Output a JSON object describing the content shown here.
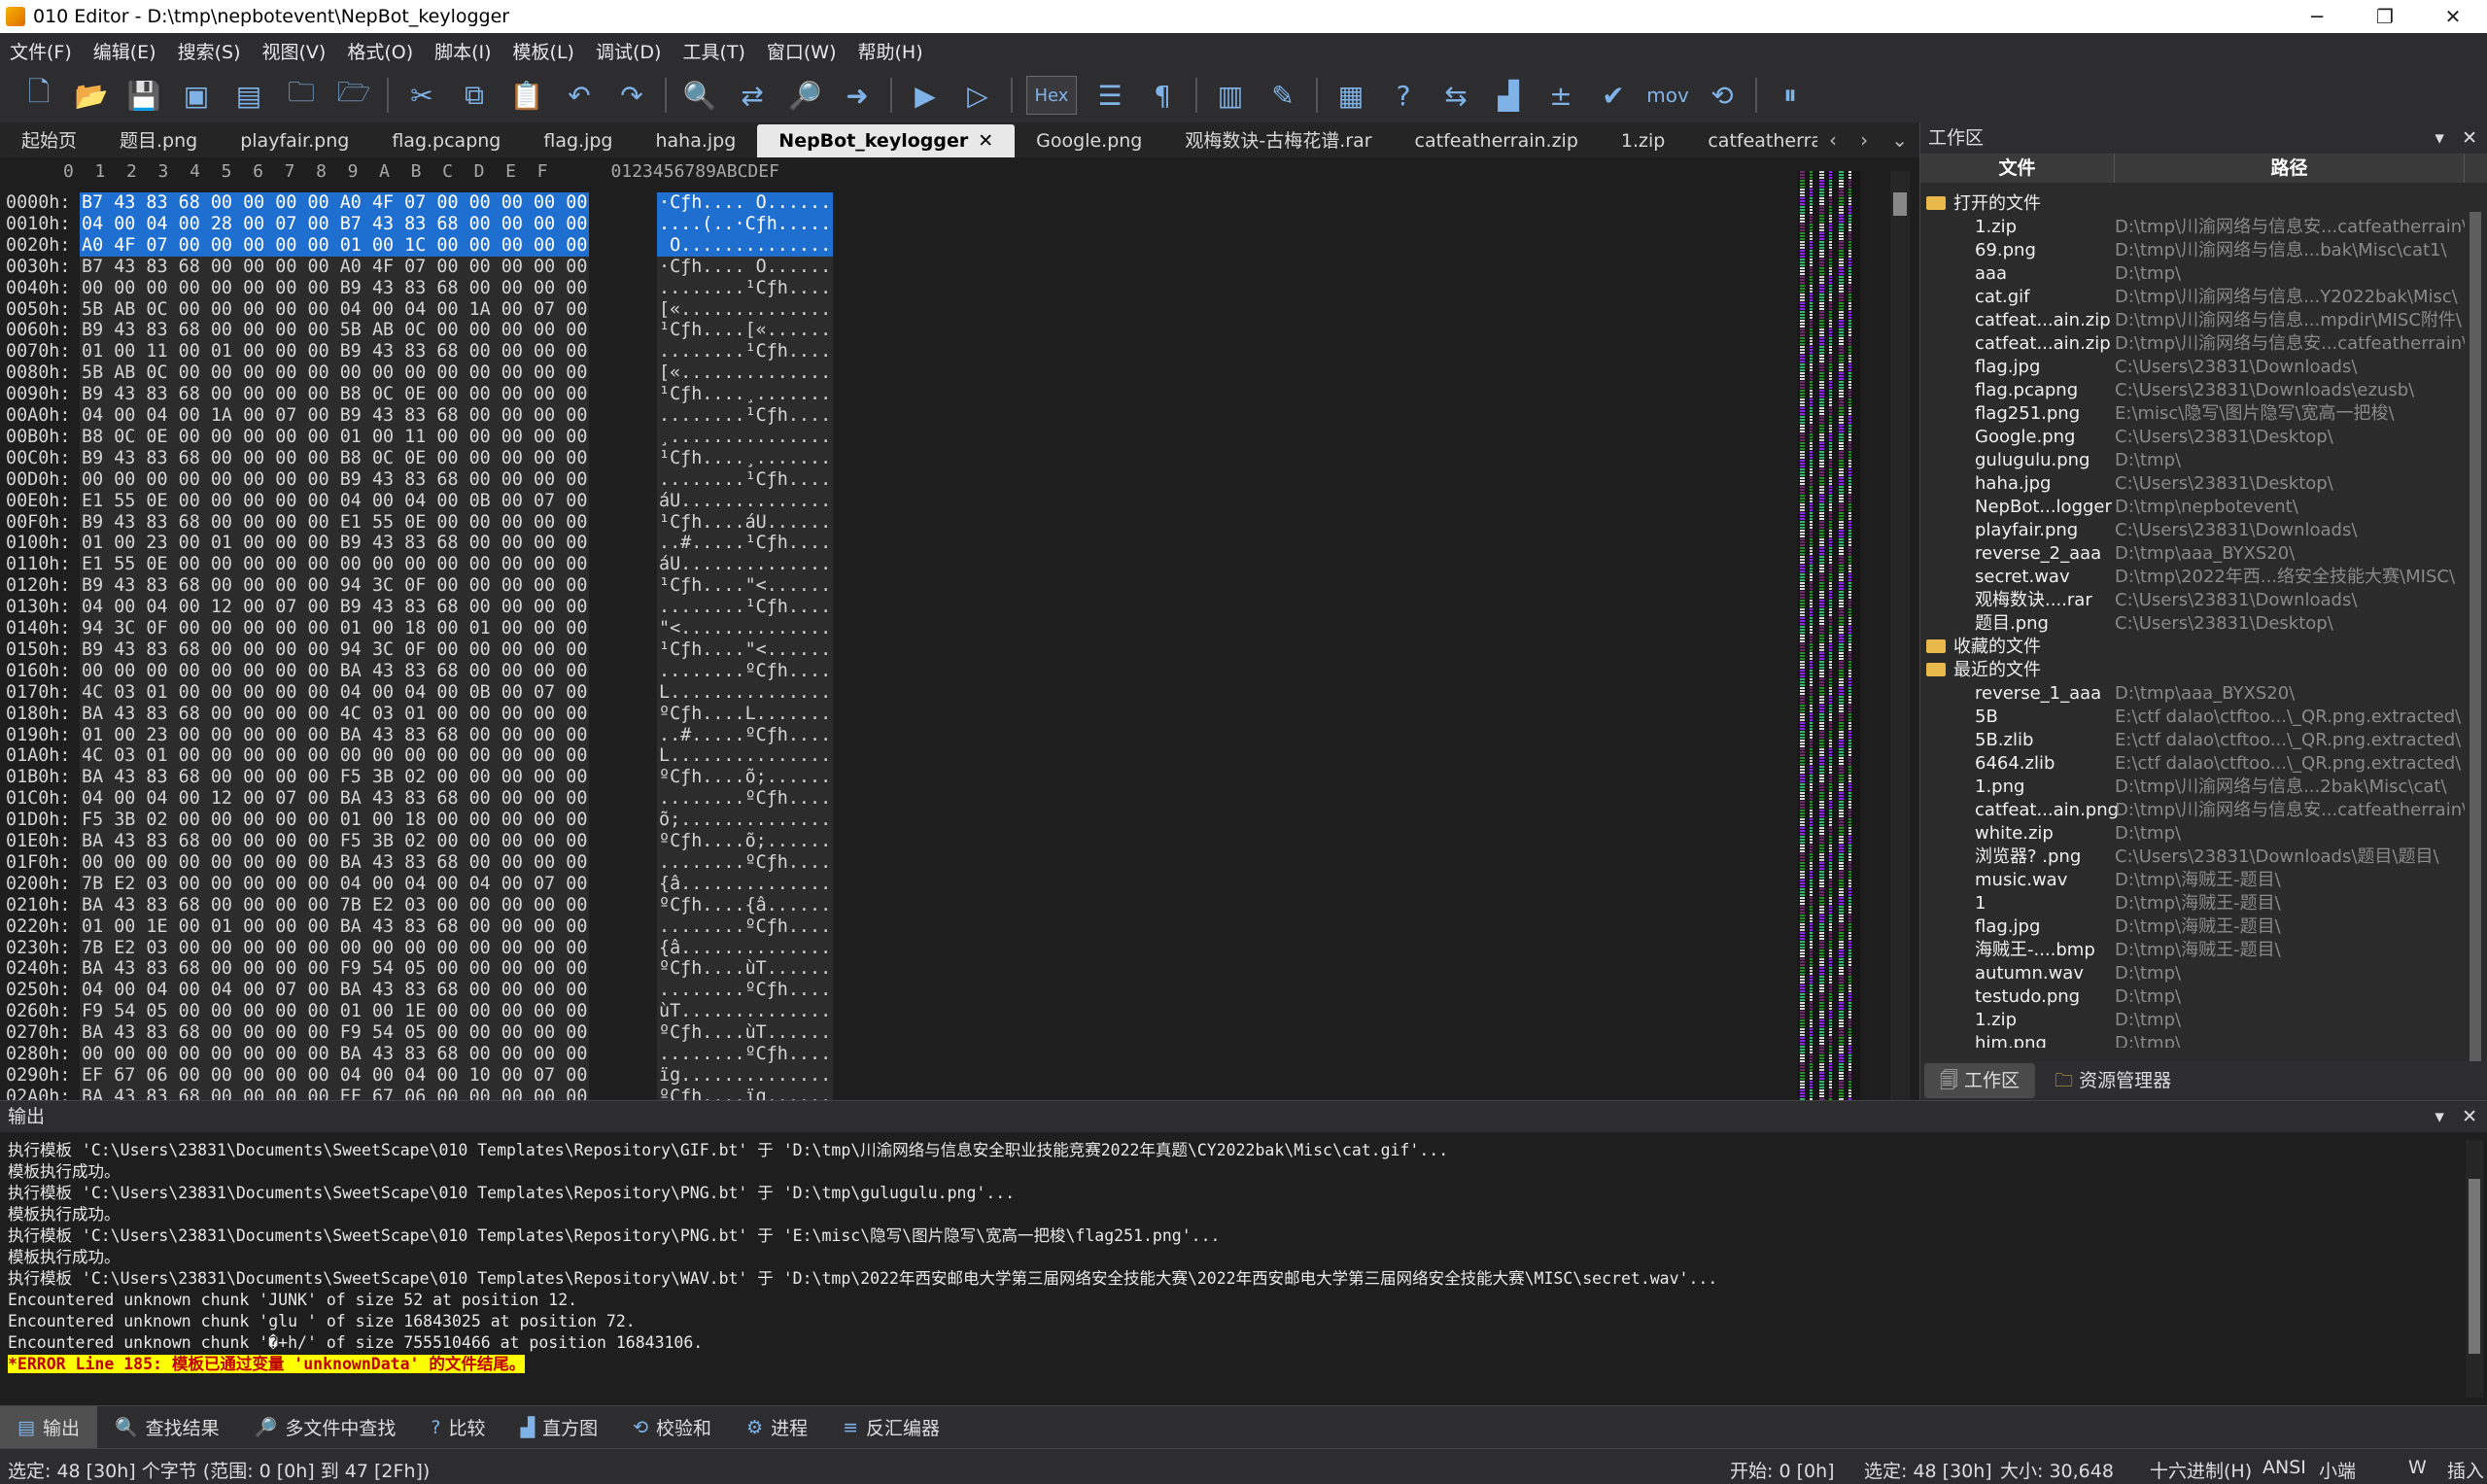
{
  "window": {
    "title": "010 Editor - D:\\tmp\\nepbotevent\\NepBot_keylogger",
    "minimize": "─",
    "maximize": "❐",
    "close": "✕"
  },
  "menu": [
    "文件(F)",
    "编辑(E)",
    "搜索(S)",
    "视图(V)",
    "格式(O)",
    "脚本(I)",
    "模板(L)",
    "调试(D)",
    "工具(T)",
    "窗口(W)",
    "帮助(H)"
  ],
  "toolbar": {
    "hex_label": "Hex",
    "mov_label": "mov",
    "icons": [
      "new-file-icon",
      "open-file-icon",
      "save-icon",
      "save-as-icon",
      "save-all-icon",
      "folder-icon",
      "open-folder-icon",
      "cut-icon",
      "copy-icon",
      "paste-icon",
      "undo-icon",
      "redo-icon",
      "find-icon",
      "replace-icon",
      "find-in-files-icon",
      "goto-icon",
      "run-script-icon",
      "run-template-icon",
      "hex-mode-icon",
      "edit-as-icon",
      "pilcrow-icon",
      "columns-icon",
      "highlight-icon",
      "calculator-icon",
      "inspector-icon",
      "compare-icon",
      "histogram-icon",
      "checksum-icon",
      "arithmetic-icon",
      "mov-icon",
      "base-convert-icon",
      "pause-icon"
    ]
  },
  "tabs": [
    "起始页",
    "题目.png",
    "playfair.png",
    "flag.pcapng",
    "flag.jpg",
    "haha.jpg",
    "NepBot_keylogger",
    "Google.png",
    "观梅数诀-古梅花谱.rar",
    "catfeatherrain.zip",
    "1.zip",
    "catfeatherrain"
  ],
  "active_tab": "NepBot_keylogger",
  "hex": {
    "header": "      0  1  2  3  4  5  6  7  8  9  A  B  C  D  E  F      0123456789ABCDEF",
    "rows": [
      {
        "addr": "0000h:",
        "bytes": "B7 43 83 68 00 00 00 00 A0 4F 07 00 00 00 00 00",
        "ascii": "·Cƒh.... O......"
      },
      {
        "addr": "0010h:",
        "bytes": "04 00 04 00 28 00 07 00 B7 43 83 68 00 00 00 00",
        "ascii": "....(..·Cƒh....."
      },
      {
        "addr": "0020h:",
        "bytes": "A0 4F 07 00 00 00 00 00 01 00 1C 00 00 00 00 00",
        "ascii": " O.............."
      },
      {
        "addr": "0030h:",
        "bytes": "B7 43 83 68 00 00 00 00 A0 4F 07 00 00 00 00 00",
        "ascii": "·Cƒh.... O......"
      },
      {
        "addr": "0040h:",
        "bytes": "00 00 00 00 00 00 00 00 B9 43 83 68 00 00 00 00",
        "ascii": "........¹Cƒh...."
      },
      {
        "addr": "0050h:",
        "bytes": "5B AB 0C 00 00 00 00 00 04 00 04 00 1A 00 07 00",
        "ascii": "[«.............."
      },
      {
        "addr": "0060h:",
        "bytes": "B9 43 83 68 00 00 00 00 5B AB 0C 00 00 00 00 00",
        "ascii": "¹Cƒh....[«......"
      },
      {
        "addr": "0070h:",
        "bytes": "01 00 11 00 01 00 00 00 B9 43 83 68 00 00 00 00",
        "ascii": "........¹Cƒh...."
      },
      {
        "addr": "0080h:",
        "bytes": "5B AB 0C 00 00 00 00 00 00 00 00 00 00 00 00 00",
        "ascii": "[«.............."
      },
      {
        "addr": "0090h:",
        "bytes": "B9 43 83 68 00 00 00 00 B8 0C 0E 00 00 00 00 00",
        "ascii": "¹Cƒh....¸......."
      },
      {
        "addr": "00A0h:",
        "bytes": "04 00 04 00 1A 00 07 00 B9 43 83 68 00 00 00 00",
        "ascii": "........¹Cƒh...."
      },
      {
        "addr": "00B0h:",
        "bytes": "B8 0C 0E 00 00 00 00 00 01 00 11 00 00 00 00 00",
        "ascii": "¸..............."
      },
      {
        "addr": "00C0h:",
        "bytes": "B9 43 83 68 00 00 00 00 B8 0C 0E 00 00 00 00 00",
        "ascii": "¹Cƒh....¸......."
      },
      {
        "addr": "00D0h:",
        "bytes": "00 00 00 00 00 00 00 00 B9 43 83 68 00 00 00 00",
        "ascii": "........¹Cƒh...."
      },
      {
        "addr": "00E0h:",
        "bytes": "E1 55 0E 00 00 00 00 00 04 00 04 00 0B 00 07 00",
        "ascii": "áU.............."
      },
      {
        "addr": "00F0h:",
        "bytes": "B9 43 83 68 00 00 00 00 E1 55 0E 00 00 00 00 00",
        "ascii": "¹Cƒh....áU......"
      },
      {
        "addr": "0100h:",
        "bytes": "01 00 23 00 01 00 00 00 B9 43 83 68 00 00 00 00",
        "ascii": "..#.....¹Cƒh...."
      },
      {
        "addr": "0110h:",
        "bytes": "E1 55 0E 00 00 00 00 00 00 00 00 00 00 00 00 00",
        "ascii": "áU.............."
      },
      {
        "addr": "0120h:",
        "bytes": "B9 43 83 68 00 00 00 00 94 3C 0F 00 00 00 00 00",
        "ascii": "¹Cƒh....\"<......"
      },
      {
        "addr": "0130h:",
        "bytes": "04 00 04 00 12 00 07 00 B9 43 83 68 00 00 00 00",
        "ascii": "........¹Cƒh...."
      },
      {
        "addr": "0140h:",
        "bytes": "94 3C 0F 00 00 00 00 00 01 00 18 00 01 00 00 00",
        "ascii": "\"<.............."
      },
      {
        "addr": "0150h:",
        "bytes": "B9 43 83 68 00 00 00 00 94 3C 0F 00 00 00 00 00",
        "ascii": "¹Cƒh....\"<......"
      },
      {
        "addr": "0160h:",
        "bytes": "00 00 00 00 00 00 00 00 BA 43 83 68 00 00 00 00",
        "ascii": "........ºCƒh...."
      },
      {
        "addr": "0170h:",
        "bytes": "4C 03 01 00 00 00 00 00 04 00 04 00 0B 00 07 00",
        "ascii": "L..............."
      },
      {
        "addr": "0180h:",
        "bytes": "BA 43 83 68 00 00 00 00 4C 03 01 00 00 00 00 00",
        "ascii": "ºCƒh....L......."
      },
      {
        "addr": "0190h:",
        "bytes": "01 00 23 00 00 00 00 00 BA 43 83 68 00 00 00 00",
        "ascii": "..#.....ºCƒh...."
      },
      {
        "addr": "01A0h:",
        "bytes": "4C 03 01 00 00 00 00 00 00 00 00 00 00 00 00 00",
        "ascii": "L..............."
      },
      {
        "addr": "01B0h:",
        "bytes": "BA 43 83 68 00 00 00 00 F5 3B 02 00 00 00 00 00",
        "ascii": "ºCƒh....õ;......"
      },
      {
        "addr": "01C0h:",
        "bytes": "04 00 04 00 12 00 07 00 BA 43 83 68 00 00 00 00",
        "ascii": "........ºCƒh...."
      },
      {
        "addr": "01D0h:",
        "bytes": "F5 3B 02 00 00 00 00 00 01 00 18 00 00 00 00 00",
        "ascii": "õ;.............."
      },
      {
        "addr": "01E0h:",
        "bytes": "BA 43 83 68 00 00 00 00 F5 3B 02 00 00 00 00 00",
        "ascii": "ºCƒh....õ;......"
      },
      {
        "addr": "01F0h:",
        "bytes": "00 00 00 00 00 00 00 00 BA 43 83 68 00 00 00 00",
        "ascii": "........ºCƒh...."
      },
      {
        "addr": "0200h:",
        "bytes": "7B E2 03 00 00 00 00 00 04 00 04 00 04 00 07 00",
        "ascii": "{â.............."
      },
      {
        "addr": "0210h:",
        "bytes": "BA 43 83 68 00 00 00 00 7B E2 03 00 00 00 00 00",
        "ascii": "ºCƒh....{â......"
      },
      {
        "addr": "0220h:",
        "bytes": "01 00 1E 00 01 00 00 00 BA 43 83 68 00 00 00 00",
        "ascii": "........ºCƒh...."
      },
      {
        "addr": "0230h:",
        "bytes": "7B E2 03 00 00 00 00 00 00 00 00 00 00 00 00 00",
        "ascii": "{â.............."
      },
      {
        "addr": "0240h:",
        "bytes": "BA 43 83 68 00 00 00 00 F9 54 05 00 00 00 00 00",
        "ascii": "ºCƒh....ùT......"
      },
      {
        "addr": "0250h:",
        "bytes": "04 00 04 00 04 00 07 00 BA 43 83 68 00 00 00 00",
        "ascii": "........ºCƒh...."
      },
      {
        "addr": "0260h:",
        "bytes": "F9 54 05 00 00 00 00 00 01 00 1E 00 00 00 00 00",
        "ascii": "ùT.............."
      },
      {
        "addr": "0270h:",
        "bytes": "BA 43 83 68 00 00 00 00 F9 54 05 00 00 00 00 00",
        "ascii": "ºCƒh....ùT......"
      },
      {
        "addr": "0280h:",
        "bytes": "00 00 00 00 00 00 00 00 BA 43 83 68 00 00 00 00",
        "ascii": "........ºCƒh...."
      },
      {
        "addr": "0290h:",
        "bytes": "EF 67 06 00 00 00 00 00 04 00 04 00 10 00 07 00",
        "ascii": "ïg.............."
      },
      {
        "addr": "02A0h:",
        "bytes": "BA 43 83 68 00 00 00 00 EF 67 06 00 00 00 00 00",
        "ascii": "ºCƒh....ïg......"
      }
    ]
  },
  "workspace": {
    "title": "工作区",
    "col_file": "文件",
    "col_path": "路径",
    "group_open": "打开的文件",
    "open_files": [
      {
        "name": "1.zip",
        "path": "D:\\tmp\\川渝网络与信息安...catfeatherrain\\"
      },
      {
        "name": "69.png",
        "path": "D:\\tmp\\川渝网络与信息...bak\\Misc\\cat1\\"
      },
      {
        "name": "aaa",
        "path": "D:\\tmp\\"
      },
      {
        "name": "cat.gif",
        "path": "D:\\tmp\\川渝网络与信息...Y2022bak\\Misc\\"
      },
      {
        "name": "catfeat...ain.zip",
        "path": "D:\\tmp\\川渝网络与信息...mpdir\\MISC附件\\"
      },
      {
        "name": "catfeat...ain.zip",
        "path": "D:\\tmp\\川渝网络与信息安...catfeatherrain\\"
      },
      {
        "name": "flag.jpg",
        "path": "C:\\Users\\23831\\Downloads\\"
      },
      {
        "name": "flag.pcapng",
        "path": "C:\\Users\\23831\\Downloads\\ezusb\\"
      },
      {
        "name": "flag251.png",
        "path": "E:\\misc\\隐写\\图片隐写\\宽高一把梭\\"
      },
      {
        "name": "Google.png",
        "path": "C:\\Users\\23831\\Desktop\\"
      },
      {
        "name": "gulugulu.png",
        "path": "D:\\tmp\\"
      },
      {
        "name": "haha.jpg",
        "path": "C:\\Users\\23831\\Desktop\\"
      },
      {
        "name": "NepBot...logger",
        "path": "D:\\tmp\\nepbotevent\\"
      },
      {
        "name": "playfair.png",
        "path": "C:\\Users\\23831\\Downloads\\"
      },
      {
        "name": "reverse_2_aaa",
        "path": "D:\\tmp\\aaa_BYXS20\\"
      },
      {
        "name": "secret.wav",
        "path": "D:\\tmp\\2022年西...络安全技能大赛\\MISC\\"
      },
      {
        "name": "观梅数诀....rar",
        "path": "C:\\Users\\23831\\Downloads\\"
      },
      {
        "name": "题目.png",
        "path": "C:\\Users\\23831\\Desktop\\"
      }
    ],
    "group_fav": "收藏的文件",
    "group_recent": "最近的文件",
    "recent_files": [
      {
        "name": "reverse_1_aaa",
        "path": "D:\\tmp\\aaa_BYXS20\\"
      },
      {
        "name": "5B",
        "path": "E:\\ctf dalao\\ctftoo...\\_QR.png.extracted\\"
      },
      {
        "name": "5B.zlib",
        "path": "E:\\ctf dalao\\ctftoo...\\_QR.png.extracted\\"
      },
      {
        "name": "6464.zlib",
        "path": "E:\\ctf dalao\\ctftoo...\\_QR.png.extracted\\"
      },
      {
        "name": "1.png",
        "path": "D:\\tmp\\川渝网络与信息...2bak\\Misc\\cat\\"
      },
      {
        "name": "catfeat...ain.png",
        "path": "D:\\tmp\\川渝网络与信息安...catfeatherrain\\"
      },
      {
        "name": "white.zip",
        "path": "D:\\tmp\\"
      },
      {
        "name": "浏览器? .png",
        "path": "C:\\Users\\23831\\Downloads\\题目\\题目\\"
      },
      {
        "name": "music.wav",
        "path": "D:\\tmp\\海贼王-题目\\"
      },
      {
        "name": "1",
        "path": "D:\\tmp\\海贼王-题目\\"
      },
      {
        "name": "flag.jpg",
        "path": "D:\\tmp\\海贼王-题目\\"
      },
      {
        "name": "海贼王-....bmp",
        "path": "D:\\tmp\\海贼王-题目\\"
      },
      {
        "name": "autumn.wav",
        "path": "D:\\tmp\\"
      },
      {
        "name": "testudo.png",
        "path": "D:\\tmp\\"
      },
      {
        "name": "1.zip",
        "path": "D:\\tmp\\"
      },
      {
        "name": "hjm.png",
        "path": "D:\\tmp\\"
      }
    ],
    "tab_workspace": "工作区",
    "tab_explorer": "资源管理器"
  },
  "output": {
    "title": "输出",
    "lines": [
      "执行模板 'C:\\Users\\23831\\Documents\\SweetScape\\010 Templates\\Repository\\GIF.bt' 于 'D:\\tmp\\川渝网络与信息安全职业技能竞赛2022年真题\\CY2022bak\\Misc\\cat.gif'...",
      "模板执行成功。",
      "执行模板 'C:\\Users\\23831\\Documents\\SweetScape\\010 Templates\\Repository\\PNG.bt' 于 'D:\\tmp\\gulugulu.png'...",
      "模板执行成功。",
      "执行模板 'C:\\Users\\23831\\Documents\\SweetScape\\010 Templates\\Repository\\PNG.bt' 于 'E:\\misc\\隐写\\图片隐写\\宽高一把梭\\flag251.png'...",
      "模板执行成功。",
      "执行模板 'C:\\Users\\23831\\Documents\\SweetScape\\010 Templates\\Repository\\WAV.bt' 于 'D:\\tmp\\2022年西安邮电大学第三届网络安全技能大赛\\2022年西安邮电大学第三届网络安全技能大赛\\MISC\\secret.wav'...",
      "Encountered unknown chunk 'JUNK' of size 52 at position 12.",
      "Encountered unknown chunk 'glu ' of size 16843025 at position 72.",
      "Encountered unknown chunk '�+h/' of size 755510466 at position 16843106."
    ],
    "error": "*ERROR Line 185: 模板已通过变量 'unknownData' 的文件结尾。"
  },
  "bottom_tabs": [
    "输出",
    "查找结果",
    "多文件中查找",
    "比较",
    "直方图",
    "校验和",
    "进程",
    "反汇编器"
  ],
  "status": {
    "left": "选定: 48 [30h] 个字节 (范围: 0 [0h] 到 47 [2Fh])",
    "start": "开始: 0 [0h]",
    "selected": "选定: 48 [30h]",
    "size": "大小: 30,648",
    "mode": "十六进制(H)",
    "encoding": "ANSI",
    "endian": "小端",
    "w": "W",
    "insert": "插入"
  }
}
